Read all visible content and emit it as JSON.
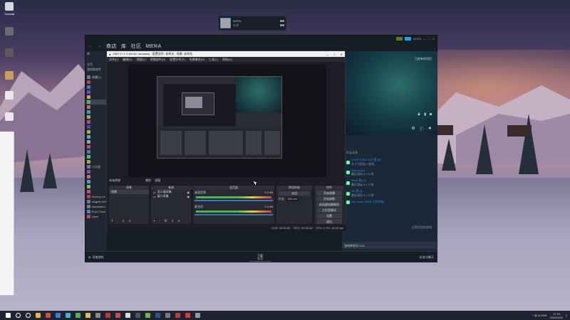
{
  "desktop": {
    "icons": [
      {
        "label": "Translat",
        "color": "#d9d9d9"
      },
      {
        "label": "",
        "color": "#6b6b6b"
      },
      {
        "label": "",
        "color": "#5a5a5a"
      },
      {
        "label": "",
        "color": "#caa055"
      },
      {
        "label": "",
        "color": "#e8e8e8"
      },
      {
        "label": "",
        "color": "#e8e8e8"
      }
    ]
  },
  "friends_popup": {
    "name": "MERA",
    "status": "在线"
  },
  "steam": {
    "top_right_label": "MERA",
    "nav": {
      "back_icon": "back-arrow-icon",
      "forward_icon": "forward-arrow-icon",
      "tabs": [
        "商店",
        "库",
        "社区",
        "MERA"
      ]
    },
    "library": {
      "header": "库",
      "home_label": "主页",
      "games_label": "游戏和软件",
      "items": [
        {
          "label": "收藏(1)",
          "color": "#6c7a89"
        },
        {
          "label": "",
          "color": "#b34a4a"
        },
        {
          "label": "",
          "color": "#4a7ab3"
        },
        {
          "label": "",
          "color": "#7a4ab3"
        },
        {
          "label": "",
          "color": "#c8a84a"
        },
        {
          "label": "",
          "color": "#4ab37a",
          "selected": true
        },
        {
          "label": "",
          "color": "#b37a4a"
        },
        {
          "label": "",
          "color": "#4a9ab3"
        },
        {
          "label": "",
          "color": "#8ab34a"
        },
        {
          "label": "",
          "color": "#b34a8a"
        },
        {
          "label": "",
          "color": "#4a4ab3"
        },
        {
          "label": "",
          "color": "#b3b34a"
        },
        {
          "label": "",
          "color": "#4ab3b3"
        },
        {
          "label": "",
          "color": "#a0a0a0"
        },
        {
          "label": "",
          "color": "#c05050"
        },
        {
          "label": "",
          "color": "#5080c0"
        },
        {
          "label": "",
          "color": "#50c080"
        },
        {
          "label": "",
          "color": "#c0a050"
        },
        {
          "label": "小分类",
          "color": "#708090"
        },
        {
          "label": "",
          "color": "#9050c0"
        },
        {
          "label": "",
          "color": "#c07050"
        },
        {
          "label": "",
          "color": "#50a0c0"
        },
        {
          "label": "",
          "color": "#80c050"
        },
        {
          "label": "",
          "color": "#c05090"
        },
        {
          "label": "Among Us",
          "color": "#c04040"
        },
        {
          "label": "Angela Sefordes",
          "color": "#6080a0"
        },
        {
          "label": "Assassin's Creed",
          "color": "#8a7a6a"
        },
        {
          "label": "Euro Truck Simulator",
          "color": "#4a8ac0"
        },
        {
          "label": "Apex",
          "color": "#c04a4a"
        }
      ]
    },
    "hero": {
      "tag": "已经有的项目",
      "activity_title": "好友动态",
      "activities": [
        {
          "name": "Z H E O M E D P 我 (8)",
          "sub": "与 3 位好友一起玩"
        },
        {
          "name": "Among Us",
          "sub": "最近游玩 5.2 小时"
        },
        {
          "name": "Stray 我 (7)",
          "sub": "最近游玩 4.1 小时"
        },
        {
          "name": "Ori 我 (2)",
          "sub": "最近游玩 2.0 小时"
        },
        {
          "name": "Ori Game 100% 工作完成",
          "sub": ""
        }
      ],
      "footer_link": "近期添加的游戏"
    },
    "bottom": {
      "left": "添加游戏",
      "center": "下载",
      "center_sub": "管理",
      "right": "好友与聊天"
    },
    "status_line": "游戏库状况 1/12"
  },
  "obs": {
    "title": "OBS 27.1.3 (64-bit, windows) - 配置文件: 未命名 - 场景: 未命名",
    "window_controls": [
      "—",
      "□",
      "✕"
    ],
    "menu": [
      "文件(F)",
      "编辑(E)",
      "视图(V)",
      "停靠部件(D)",
      "配置文件(P)",
      "场景集合(S)",
      "工具(T)",
      "帮助(H)"
    ],
    "scene_bar": [
      "未选择源",
      "属性",
      "滤镜"
    ],
    "docks": {
      "scenes": {
        "header": "场景",
        "items": [
          "场景"
        ],
        "footer": "+ - ∧ ∨"
      },
      "sources": {
        "header": "来源",
        "items": [
          "显示器采集",
          "窗口采集"
        ],
        "footer": "+ - ⚙ ∧ ∨"
      },
      "mixer": {
        "header": "混音器",
        "rows": [
          {
            "label": "桌面音频",
            "db": "0.0 dB"
          },
          {
            "label": "麦克风",
            "db": "0.0 dB"
          }
        ]
      },
      "transitions": {
        "header": "转场特效",
        "mode": "淡出",
        "duration_label": "时长",
        "duration": "300 ms"
      },
      "controls": {
        "header": "控件",
        "buttons": [
          "开始直播",
          "开始录制",
          "启动虚拟摄像机",
          "工作室模式",
          "设置",
          "退出"
        ]
      }
    },
    "status": [
      "LIVE: 00:00:00",
      "REC: 00:00:00",
      "CPU: 2.3%, 60.00 fps"
    ]
  },
  "taskbar": {
    "apps": [
      {
        "name": "windows-start-icon",
        "color": "#ffffff"
      },
      {
        "name": "search-icon",
        "color": "#ffffff"
      },
      {
        "name": "task-view-icon",
        "color": "#ffffff"
      },
      {
        "name": "chrome-icon",
        "color": "#e8b33a"
      },
      {
        "name": "app-red-icon",
        "color": "#d94a3a"
      },
      {
        "name": "app-blue-icon",
        "color": "#3a7ad9"
      },
      {
        "name": "edge-icon",
        "color": "#3ab0d9"
      },
      {
        "name": "app-green-icon",
        "color": "#4ab35a"
      },
      {
        "name": "folder-icon",
        "color": "#e0c04a"
      },
      {
        "name": "app-gray-icon",
        "color": "#8a8a8a"
      },
      {
        "name": "app-red2-icon",
        "color": "#c03a3a"
      },
      {
        "name": "app-red3-icon",
        "color": "#d04a4a"
      },
      {
        "name": "app-white-icon",
        "color": "#dddddd"
      },
      {
        "name": "obs-icon",
        "color": "#555555"
      },
      {
        "name": "app-green2-icon",
        "color": "#6ab34a"
      },
      {
        "name": "steam-icon",
        "color": "#2a5a8a"
      },
      {
        "name": "app-gray2-icon",
        "color": "#7a7a7a"
      },
      {
        "name": "app-red4-icon",
        "color": "#c03a3a"
      },
      {
        "name": "app-red5-icon",
        "color": "#d93a3a"
      },
      {
        "name": "app-gray3-icon",
        "color": "#9a9a9a"
      }
    ],
    "tray": "^ ◍ ⊡ ENG",
    "time": "17:15",
    "date": "2022/1/24"
  }
}
